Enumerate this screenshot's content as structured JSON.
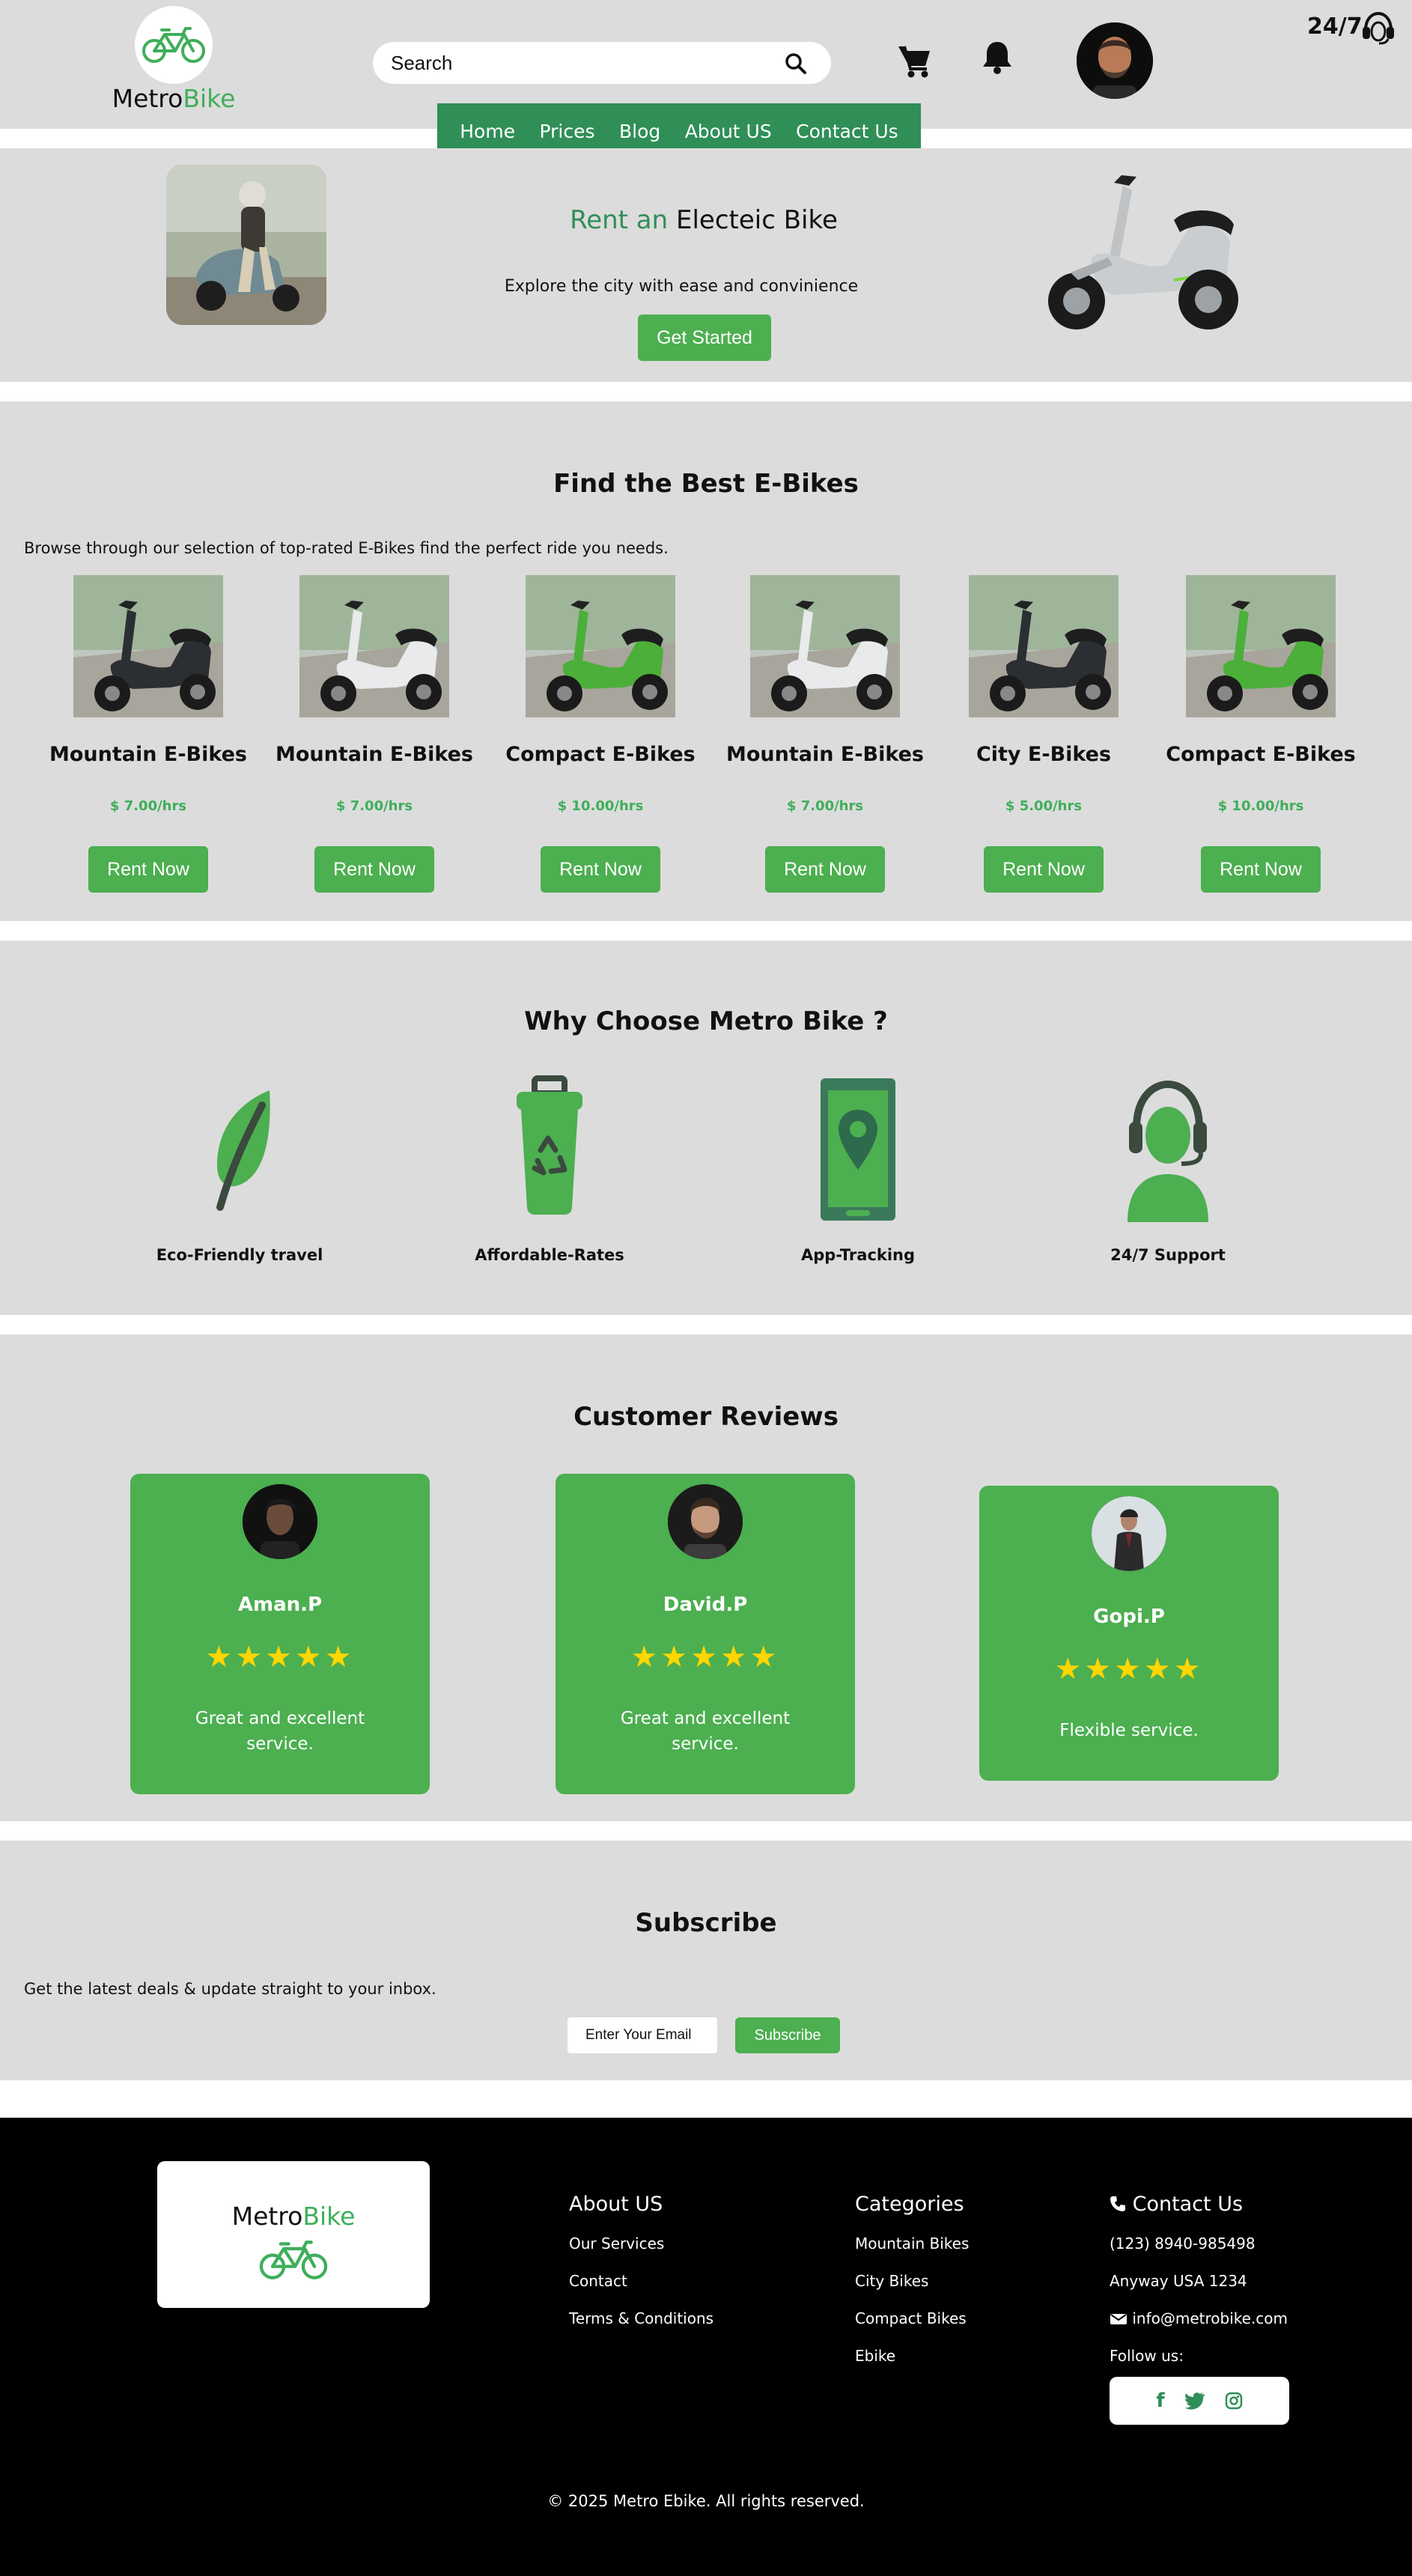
{
  "brand": {
    "name_part1": "Metro",
    "name_part2": "Bike",
    "accent": "#3fae5a"
  },
  "header": {
    "search_placeholder": "Search",
    "support_label": "24/7",
    "icons": [
      "bicycle-icon",
      "search-icon",
      "cart-icon",
      "bell-icon",
      "avatar",
      "headset-icon"
    ]
  },
  "nav": {
    "items": [
      "Home",
      "Prices",
      "Blog",
      "About US",
      "Contact Us"
    ]
  },
  "hero": {
    "title_part1": "Rent an",
    "title_part2": "Electeic Bike",
    "subtitle": "Explore the city with ease and convinience",
    "cta": "Get Started"
  },
  "fleet": {
    "title": "Find the Best E-Bikes",
    "intro": "Browse through our selection of top-rated E-Bikes find the perfect ride you needs.",
    "bikes": [
      {
        "name": "Mountain E-Bikes",
        "price": "$ 7.00/hrs",
        "cta": "Rent Now",
        "color": "#2b2f33"
      },
      {
        "name": "Mountain E-Bikes",
        "price": "$ 7.00/hrs",
        "cta": "Rent Now",
        "color": "#e8eaec"
      },
      {
        "name": "Compact E-Bikes",
        "price": "$ 10.00/hrs",
        "cta": "Rent Now",
        "color": "#4caf3a"
      },
      {
        "name": "Mountain E-Bikes",
        "price": "$ 7.00/hrs",
        "cta": "Rent Now",
        "color": "#e8eaec"
      },
      {
        "name": "City E-Bikes",
        "price": "$ 5.00/hrs",
        "cta": "Rent Now",
        "color": "#2b2f33"
      },
      {
        "name": "Compact E-Bikes",
        "price": "$ 10.00/hrs",
        "cta": "Rent Now",
        "color": "#4caf3a"
      }
    ]
  },
  "why": {
    "title": "Why Choose Metro Bike ?",
    "features": [
      {
        "label": "Eco-Friendly travel",
        "icon": "leaf-icon"
      },
      {
        "label": "Affordable-Rates",
        "icon": "recycle-bin-icon"
      },
      {
        "label": "App-Tracking",
        "icon": "phone-location-icon"
      },
      {
        "label": "24/7 Support",
        "icon": "support-agent-icon"
      }
    ]
  },
  "reviews": {
    "title": "Customer Reviews",
    "items": [
      {
        "name": "Aman.P",
        "stars": "★★★★★",
        "text": "Great and excellent service."
      },
      {
        "name": "David.P",
        "stars": "★★★★★",
        "text": "Great and excellent service."
      },
      {
        "name": "Gopi.P",
        "stars": "★★★★★",
        "text": "Flexible service."
      }
    ]
  },
  "subscribe": {
    "title": "Subscribe",
    "intro": "Get the latest deals & update straight to your inbox.",
    "placeholder": "Enter Your Email",
    "cta": "Subscribe"
  },
  "footer": {
    "about": {
      "title": "About US",
      "links": [
        "Our Services",
        "Contact",
        "Terms & Conditions"
      ]
    },
    "categories": {
      "title": "Categories",
      "links": [
        "Mountain Bikes",
        "City Bikes",
        "Compact Bikes",
        "Ebike"
      ]
    },
    "contact": {
      "title": "Contact Us",
      "phone": "(123) 8940-985498",
      "address": "Anyway USA 1234",
      "email": "info@metrobike.com",
      "follow": "Follow us:"
    },
    "social": [
      "f",
      "t",
      "◎"
    ],
    "copyright": "© 2025 Metro Ebike. All rights reserved."
  }
}
